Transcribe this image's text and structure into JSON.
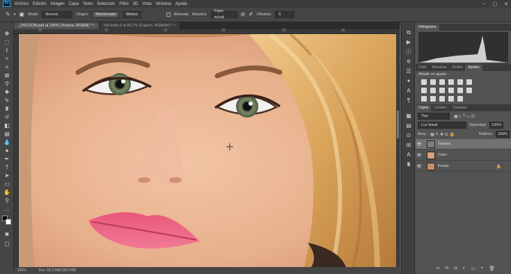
{
  "app": {
    "logo_text": "Ps"
  },
  "menu": [
    "Archivo",
    "Edición",
    "Imagen",
    "Capa",
    "Texto",
    "Selección",
    "Filtro",
    "3D",
    "Vista",
    "Ventana",
    "Ayuda"
  ],
  "window_controls": [
    "–",
    "▢",
    "✕"
  ],
  "options": {
    "mode_label": "Modo:",
    "mode_value": "Normal",
    "origin_label": "Origen:",
    "sampled_button": "Muestreado",
    "pattern_button": "Motivo",
    "aligned_label": "Alineado",
    "sample_label": "Muestra:",
    "sample_value": "Capa actual",
    "diffusion_label": "Difusión:",
    "diffusion_value": "5"
  },
  "tabs": [
    {
      "label": "_DSC0138.psd al 100% (Textura, RGB/8) * ×",
      "active": true
    },
    {
      "label": "Sin título-3 al 66,7% (Capa 5, RGB/8#) * ×",
      "active": false
    }
  ],
  "ruler_numbers": [
    "10",
    "15",
    "20",
    "25",
    "30",
    "35"
  ],
  "status": {
    "zoom": "100%",
    "doc": "Doc: 53,3 MB/199,9 MB"
  },
  "panels": {
    "histogram_tab": "Histograma",
    "adjust_tabs": [
      "Color",
      "Muestras",
      "Estilos",
      "Ajustes"
    ],
    "adjust_hint": "Añadir un ajuste",
    "layer_tabs": [
      "Capas",
      "Canales",
      "Trazados"
    ],
    "kind_filter": "Tipo",
    "blend_mode": "Luz lineal",
    "opacity_label": "Opacidad:",
    "opacity_value": "100%",
    "lock_label": "Bloq.:",
    "fill_label": "Relleno:",
    "fill_value": "100%",
    "layers": [
      {
        "name": "Textura",
        "selected": true,
        "thumb": "#7d7d7d"
      },
      {
        "name": "Color",
        "selected": false,
        "thumb": "#d9a37c"
      },
      {
        "name": "Fondo",
        "selected": false,
        "thumb": "#c98e68"
      }
    ],
    "footer_icons": [
      "∞",
      "fx",
      "◘",
      "◐",
      "▭",
      "+",
      "🗑"
    ]
  }
}
